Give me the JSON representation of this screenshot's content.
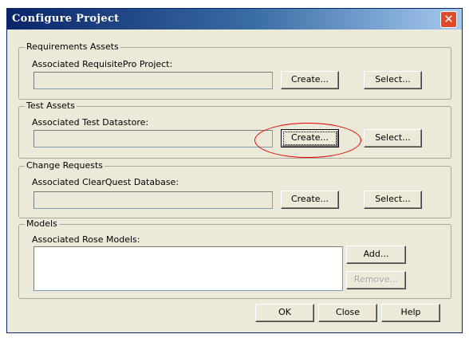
{
  "window": {
    "title": "Configure Project",
    "close_glyph": "✕",
    "close_color": "#e04a2a"
  },
  "requirements": {
    "group_label": "Requirements Assets",
    "field_label": "Associated RequisitePro Project:",
    "value": "",
    "create_label": "Create...",
    "select_label": "Select..."
  },
  "test": {
    "group_label": "Test Assets",
    "field_label": "Associated Test Datastore:",
    "value": "",
    "create_label": "Create...",
    "select_label": "Select..."
  },
  "change": {
    "group_label": "Change Requests",
    "field_label": "Associated ClearQuest Database:",
    "value": "",
    "create_label": "Create...",
    "select_label": "Select..."
  },
  "models": {
    "group_label": "Models",
    "field_label": "Associated Rose Models:",
    "items": [],
    "add_label": "Add...",
    "remove_label": "Remove..."
  },
  "footer": {
    "ok_label": "OK",
    "close_label": "Close",
    "help_label": "Help"
  },
  "highlight": {
    "shape": "ellipse",
    "color": "#e00000"
  }
}
